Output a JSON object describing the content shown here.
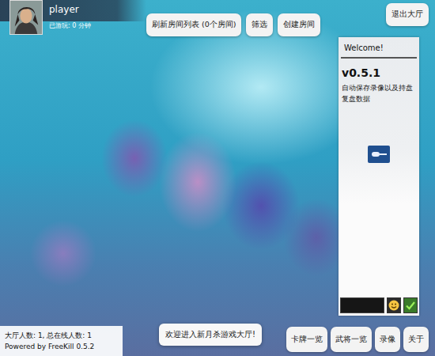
{
  "player": {
    "name": "player",
    "playtime": "已游玩: 0 分钟"
  },
  "toolbar": {
    "buttons": [
      "刷新房间列表 (0个房间)",
      "筛选",
      "创建房间"
    ],
    "exit": "退出大厅"
  },
  "chat": {
    "title": "Welcome!",
    "messages": [
      {
        "heading": "v0.5.1",
        "body": "自动保存录像以及持盘复盘数据"
      }
    ],
    "input": {
      "value": ""
    }
  },
  "status": {
    "counts": "大厅人数: 1, 总在线人数: 1",
    "powered_by": "Powered by FreeKill 0.5.2"
  },
  "toast": "欢迎进入新月杀游戏大厅!",
  "menu": [
    "卡牌一览",
    "武将一览",
    "录像",
    "关于"
  ]
}
